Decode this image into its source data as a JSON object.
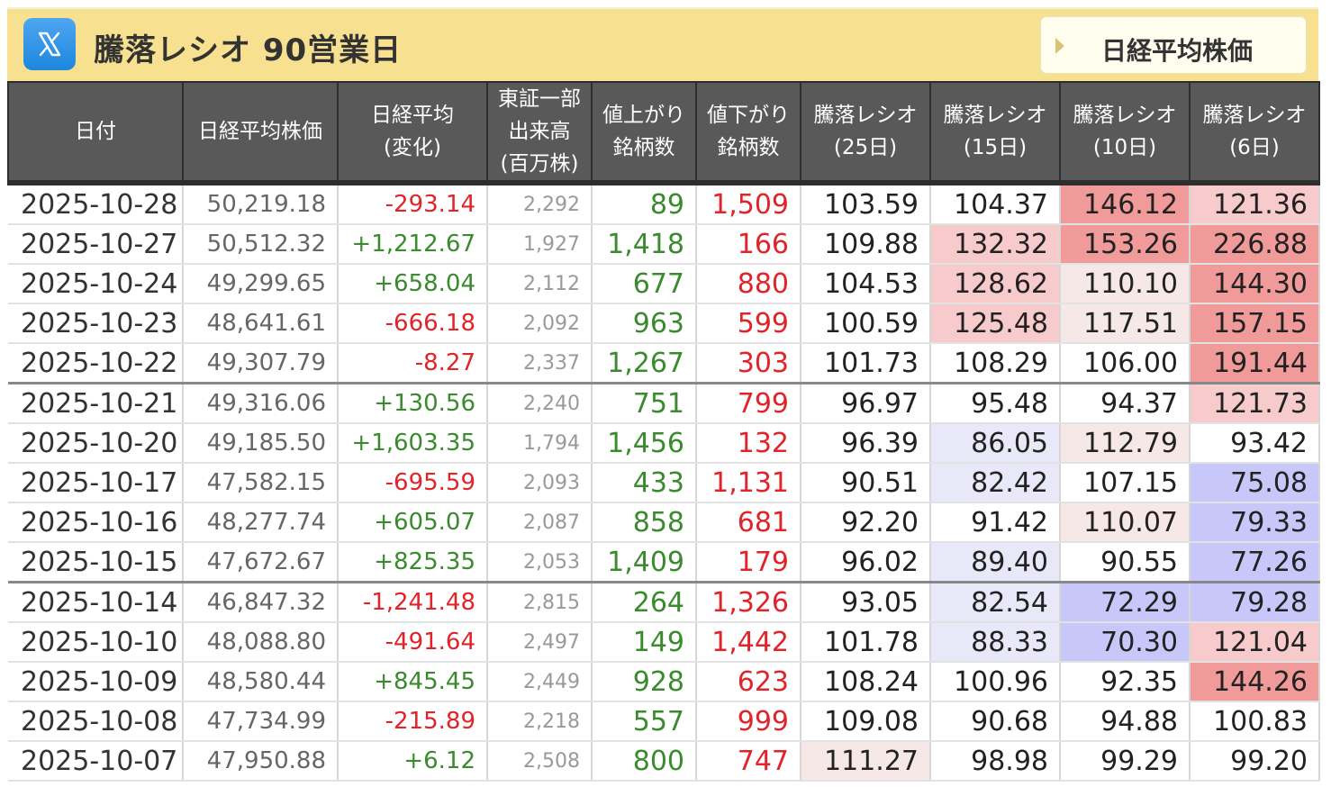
{
  "header": {
    "title": "騰落レシオ 90営業日",
    "nav_button_label": "日経平均株価"
  },
  "colors": {
    "header_bg": "#f7e08f",
    "table_header_bg": "#595959",
    "rise": "#3a8a2e",
    "fall": "#e0242a",
    "high_strong": "#f19a9a",
    "high_medium": "#f7cbcb",
    "high_light": "#f7e8e8",
    "low_strong": "#c7c7fa",
    "low_light": "#e8e8f8"
  },
  "table": {
    "columns": [
      [
        "日付"
      ],
      [
        "日経平均株価"
      ],
      [
        "日経平均",
        "(変化)"
      ],
      [
        "東証一部",
        "出来高",
        "(百万株)"
      ],
      [
        "値上がり",
        "銘柄数"
      ],
      [
        "値下がり",
        "銘柄数"
      ],
      [
        "騰落レシオ",
        "(25日)"
      ],
      [
        "騰落レシオ",
        "(15日)"
      ],
      [
        "騰落レシオ",
        "(10日)"
      ],
      [
        "騰落レシオ",
        "(6日)"
      ]
    ],
    "rows": [
      {
        "date": "2025-10-28",
        "nikkei": "50,219.18",
        "change": "-293.14",
        "volume": "2,292",
        "advances": "89",
        "declines": "1,509",
        "r25": "103.59",
        "r15": "104.37",
        "r10": "146.12",
        "r6": "121.36",
        "h25": "",
        "h15": "",
        "h10": "high_strong",
        "h6": "high_medium",
        "sep": false
      },
      {
        "date": "2025-10-27",
        "nikkei": "50,512.32",
        "change": "+1,212.67",
        "volume": "1,927",
        "advances": "1,418",
        "declines": "166",
        "r25": "109.88",
        "r15": "132.32",
        "r10": "153.26",
        "r6": "226.88",
        "h25": "",
        "h15": "high_medium",
        "h10": "high_strong",
        "h6": "high_strong",
        "sep": false
      },
      {
        "date": "2025-10-24",
        "nikkei": "49,299.65",
        "change": "+658.04",
        "volume": "2,112",
        "advances": "677",
        "declines": "880",
        "r25": "104.53",
        "r15": "128.62",
        "r10": "110.10",
        "r6": "144.30",
        "h25": "",
        "h15": "high_medium",
        "h10": "high_light",
        "h6": "high_strong",
        "sep": false
      },
      {
        "date": "2025-10-23",
        "nikkei": "48,641.61",
        "change": "-666.18",
        "volume": "2,092",
        "advances": "963",
        "declines": "599",
        "r25": "100.59",
        "r15": "125.48",
        "r10": "117.51",
        "r6": "157.15",
        "h25": "",
        "h15": "high_medium",
        "h10": "high_light",
        "h6": "high_strong",
        "sep": false
      },
      {
        "date": "2025-10-22",
        "nikkei": "49,307.79",
        "change": "-8.27",
        "volume": "2,337",
        "advances": "1,267",
        "declines": "303",
        "r25": "101.73",
        "r15": "108.29",
        "r10": "106.00",
        "r6": "191.44",
        "h25": "",
        "h15": "",
        "h10": "",
        "h6": "high_strong",
        "sep": false
      },
      {
        "date": "2025-10-21",
        "nikkei": "49,316.06",
        "change": "+130.56",
        "volume": "2,240",
        "advances": "751",
        "declines": "799",
        "r25": "96.97",
        "r15": "95.48",
        "r10": "94.37",
        "r6": "121.73",
        "h25": "",
        "h15": "",
        "h10": "",
        "h6": "high_medium",
        "sep": true
      },
      {
        "date": "2025-10-20",
        "nikkei": "49,185.50",
        "change": "+1,603.35",
        "volume": "1,794",
        "advances": "1,456",
        "declines": "132",
        "r25": "96.39",
        "r15": "86.05",
        "r10": "112.79",
        "r6": "93.42",
        "h25": "",
        "h15": "low_light",
        "h10": "high_light",
        "h6": "",
        "sep": false
      },
      {
        "date": "2025-10-17",
        "nikkei": "47,582.15",
        "change": "-695.59",
        "volume": "2,093",
        "advances": "433",
        "declines": "1,131",
        "r25": "90.51",
        "r15": "82.42",
        "r10": "107.15",
        "r6": "75.08",
        "h25": "",
        "h15": "low_light",
        "h10": "",
        "h6": "low_strong",
        "sep": false
      },
      {
        "date": "2025-10-16",
        "nikkei": "48,277.74",
        "change": "+605.07",
        "volume": "2,087",
        "advances": "858",
        "declines": "681",
        "r25": "92.20",
        "r15": "91.42",
        "r10": "110.07",
        "r6": "79.33",
        "h25": "",
        "h15": "",
        "h10": "high_light",
        "h6": "low_strong",
        "sep": false
      },
      {
        "date": "2025-10-15",
        "nikkei": "47,672.67",
        "change": "+825.35",
        "volume": "2,053",
        "advances": "1,409",
        "declines": "179",
        "r25": "96.02",
        "r15": "89.40",
        "r10": "90.55",
        "r6": "77.26",
        "h25": "",
        "h15": "low_light",
        "h10": "",
        "h6": "low_strong",
        "sep": false
      },
      {
        "date": "2025-10-14",
        "nikkei": "46,847.32",
        "change": "-1,241.48",
        "volume": "2,815",
        "advances": "264",
        "declines": "1,326",
        "r25": "93.05",
        "r15": "82.54",
        "r10": "72.29",
        "r6": "79.28",
        "h25": "",
        "h15": "low_light",
        "h10": "low_strong",
        "h6": "low_strong",
        "sep": true
      },
      {
        "date": "2025-10-10",
        "nikkei": "48,088.80",
        "change": "-491.64",
        "volume": "2,497",
        "advances": "149",
        "declines": "1,442",
        "r25": "101.78",
        "r15": "88.33",
        "r10": "70.30",
        "r6": "121.04",
        "h25": "",
        "h15": "low_light",
        "h10": "low_strong",
        "h6": "high_medium",
        "sep": false
      },
      {
        "date": "2025-10-09",
        "nikkei": "48,580.44",
        "change": "+845.45",
        "volume": "2,449",
        "advances": "928",
        "declines": "623",
        "r25": "108.24",
        "r15": "100.96",
        "r10": "92.35",
        "r6": "144.26",
        "h25": "",
        "h15": "",
        "h10": "",
        "h6": "high_strong",
        "sep": false
      },
      {
        "date": "2025-10-08",
        "nikkei": "47,734.99",
        "change": "-215.89",
        "volume": "2,218",
        "advances": "557",
        "declines": "999",
        "r25": "109.08",
        "r15": "90.68",
        "r10": "94.88",
        "r6": "100.83",
        "h25": "",
        "h15": "",
        "h10": "",
        "h6": "",
        "sep": false
      },
      {
        "date": "2025-10-07",
        "nikkei": "47,950.88",
        "change": "+6.12",
        "volume": "2,508",
        "advances": "800",
        "declines": "747",
        "r25": "111.27",
        "r15": "98.98",
        "r10": "99.29",
        "r6": "99.20",
        "h25": "high_light",
        "h15": "",
        "h10": "",
        "h6": "",
        "sep": false
      }
    ]
  }
}
